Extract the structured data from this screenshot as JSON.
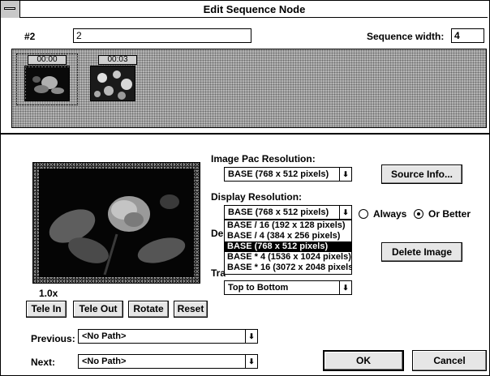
{
  "window": {
    "title": "Edit Sequence Node"
  },
  "header": {
    "node_id": "#2",
    "node_name": "2",
    "sequence_width_label": "Sequence width:",
    "sequence_width_value": "4"
  },
  "frames": [
    {
      "time": "00:00",
      "selected": true
    },
    {
      "time": "00:03",
      "selected": false
    }
  ],
  "image_pac_resolution": {
    "label": "Image Pac Resolution:",
    "value": "BASE (768 x 512 pixels)"
  },
  "display_resolution": {
    "label": "Display Resolution:",
    "value": "BASE (768 x 512 pixels)",
    "options": [
      "BASE / 16 (192 x 128 pixels)",
      "BASE / 4 (384 x 256 pixels)",
      "BASE (768 x 512 pixels)",
      "BASE * 4 (1536 x 1024 pixels)",
      "BASE * 16 (3072 x 2048 pixels)"
    ],
    "selected_index": 2
  },
  "match_mode": {
    "always_label": "Always",
    "or_better_label": "Or Better",
    "selected": "or_better"
  },
  "partial_labels": {
    "de": "De",
    "tra": "Tra"
  },
  "transition": {
    "value": "Top to Bottom"
  },
  "zoom_text": "1.0x",
  "buttons": {
    "source_info": "Source Info...",
    "delete_image": "Delete Image",
    "tele_in": "Tele In",
    "tele_out": "Tele Out",
    "rotate": "Rotate",
    "reset": "Reset",
    "ok": "OK",
    "cancel": "Cancel"
  },
  "previous": {
    "label": "Previous:",
    "value": "<No Path>"
  },
  "next": {
    "label": "Next:",
    "value": "<No Path>"
  },
  "icons": {
    "dropdown": "down-arrow-icon",
    "system_menu": "system-menu-icon"
  }
}
